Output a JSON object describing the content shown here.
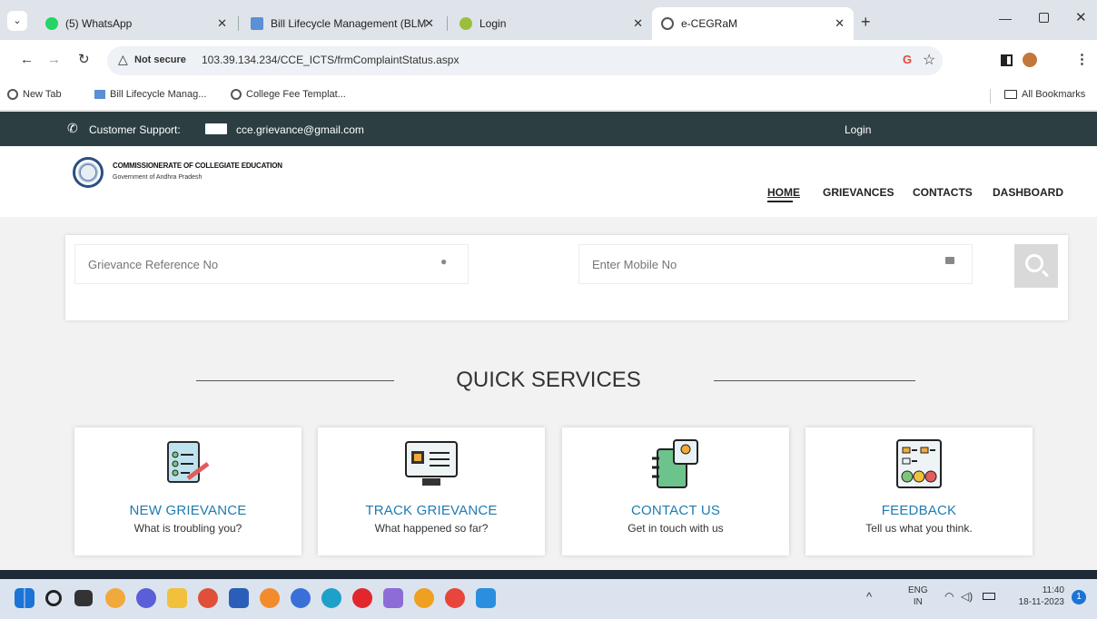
{
  "browser": {
    "tabs": [
      {
        "title": "(5) WhatsApp",
        "color": "#25d366"
      },
      {
        "title": "Bill Lifecycle Management (BLM",
        "color": "#5b8fd6"
      },
      {
        "title": "Login",
        "color": "#9bbf3a"
      },
      {
        "title": "e-CEGRaM",
        "color": "#555"
      }
    ],
    "not_secure": "Not secure",
    "url": "103.39.134.234/CCE_ICTS/frmComplaintStatus.aspx",
    "bookmarks": [
      "New Tab",
      "Bill Lifecycle Manag...",
      "College Fee Templat..."
    ],
    "all_bookmarks": "All Bookmarks"
  },
  "site": {
    "customer_support": "Customer Support:",
    "email": "cce.grievance@gmail.com",
    "login": "Login",
    "org_name": "COMMISSIONERATE OF COLLEGIATE EDUCATION",
    "org_sub": "Government of Andhra Pradesh",
    "nav": [
      "HOME",
      "GRIEVANCES",
      "CONTACTS",
      "DASHBOARD"
    ]
  },
  "search": {
    "ref_placeholder": "Grievance Reference No",
    "mobile_placeholder": "Enter Mobile No"
  },
  "quick_services": {
    "heading": "QUICK SERVICES",
    "cards": [
      {
        "title": "NEW GRIEVANCE",
        "subtitle": "What is troubling you?"
      },
      {
        "title": "TRACK GRIEVANCE",
        "subtitle": "What happened so far?"
      },
      {
        "title": "CONTACT US",
        "subtitle": "Get in touch with us"
      },
      {
        "title": "FEEDBACK",
        "subtitle": "Tell us what you think."
      }
    ]
  },
  "taskbar": {
    "lang": "ENG",
    "region": "IN",
    "time": "11:40",
    "date": "18-11-2023",
    "badge": "1"
  }
}
